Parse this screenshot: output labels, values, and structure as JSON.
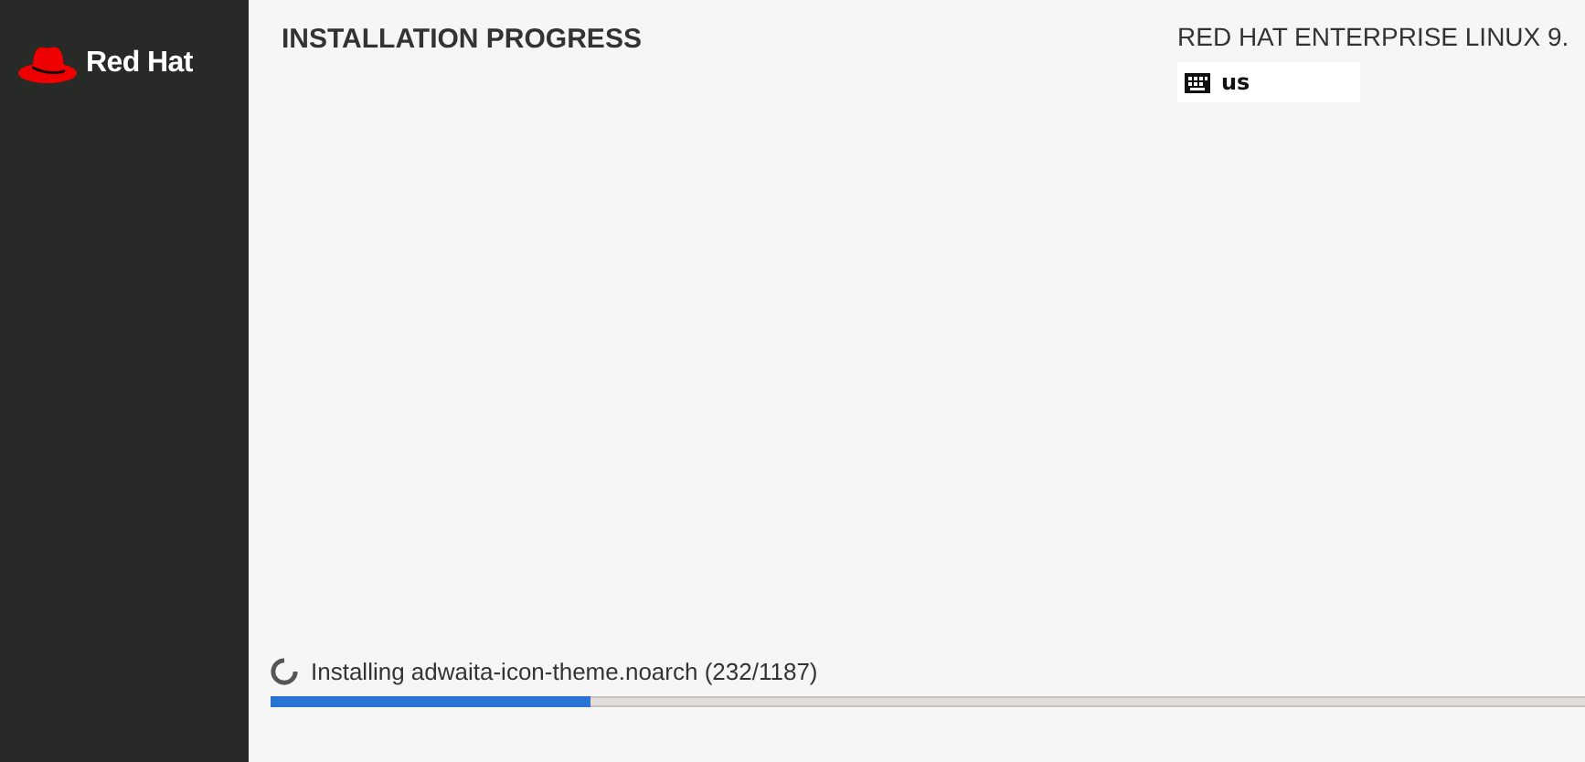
{
  "sidebar": {
    "logo_text": "Red Hat"
  },
  "header": {
    "title": "INSTALLATION PROGRESS",
    "product": "RED HAT ENTERPRISE LINUX 9.",
    "keyboard_layout": "us"
  },
  "progress": {
    "message": "Installing adwaita-icon-theme.noarch (232/1187)",
    "level": 0.244
  }
}
